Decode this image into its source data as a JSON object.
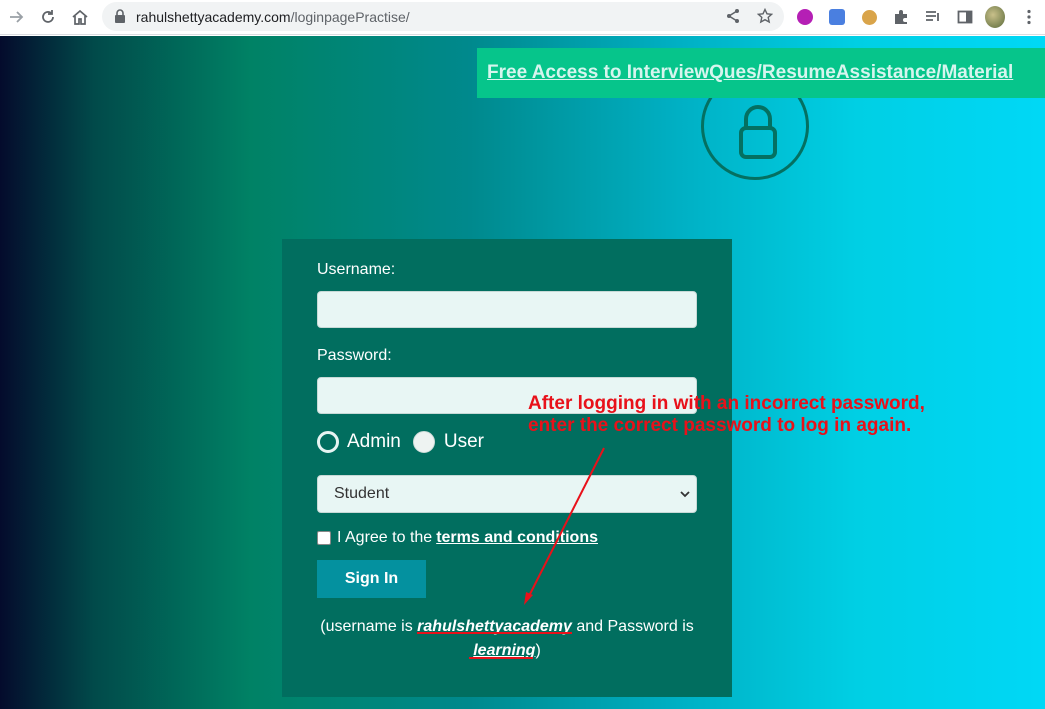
{
  "browser": {
    "url_domain": "rahulshettyacademy.com",
    "url_path": "/loginpagePractise/",
    "extensions": [
      "extension-lr-icon",
      "google-translate-icon",
      "cookie-icon",
      "puzzle-icon",
      "reading-list-icon",
      "side-panel-icon",
      "profile-avatar",
      "menu-icon"
    ]
  },
  "banner": {
    "link_text": "Free Access to InterviewQues/ResumeAssistance/Material"
  },
  "form": {
    "username_label": "Username:",
    "username_value": "",
    "password_label": "Password:",
    "password_value": "",
    "radio_admin": "Admin",
    "radio_user": "User",
    "selected_role": "Admin",
    "select_value": "Student",
    "agree_text": "I Agree to the",
    "terms_link": "terms and conditions",
    "signin_label": "Sign In",
    "hint_prefix": "(username is",
    "hint_username": "rahulshettyacademy",
    "hint_middle": "and Password is",
    "hint_password": "learning",
    "hint_suffix": ")"
  },
  "annotation": {
    "line1": "After logging in with an incorrect password,",
    "line2": "enter the correct password to log in again."
  },
  "colors": {
    "card": "#016e5f",
    "banner": "#06c58b",
    "signin": "#04919f",
    "annotation": "#e8111a"
  }
}
